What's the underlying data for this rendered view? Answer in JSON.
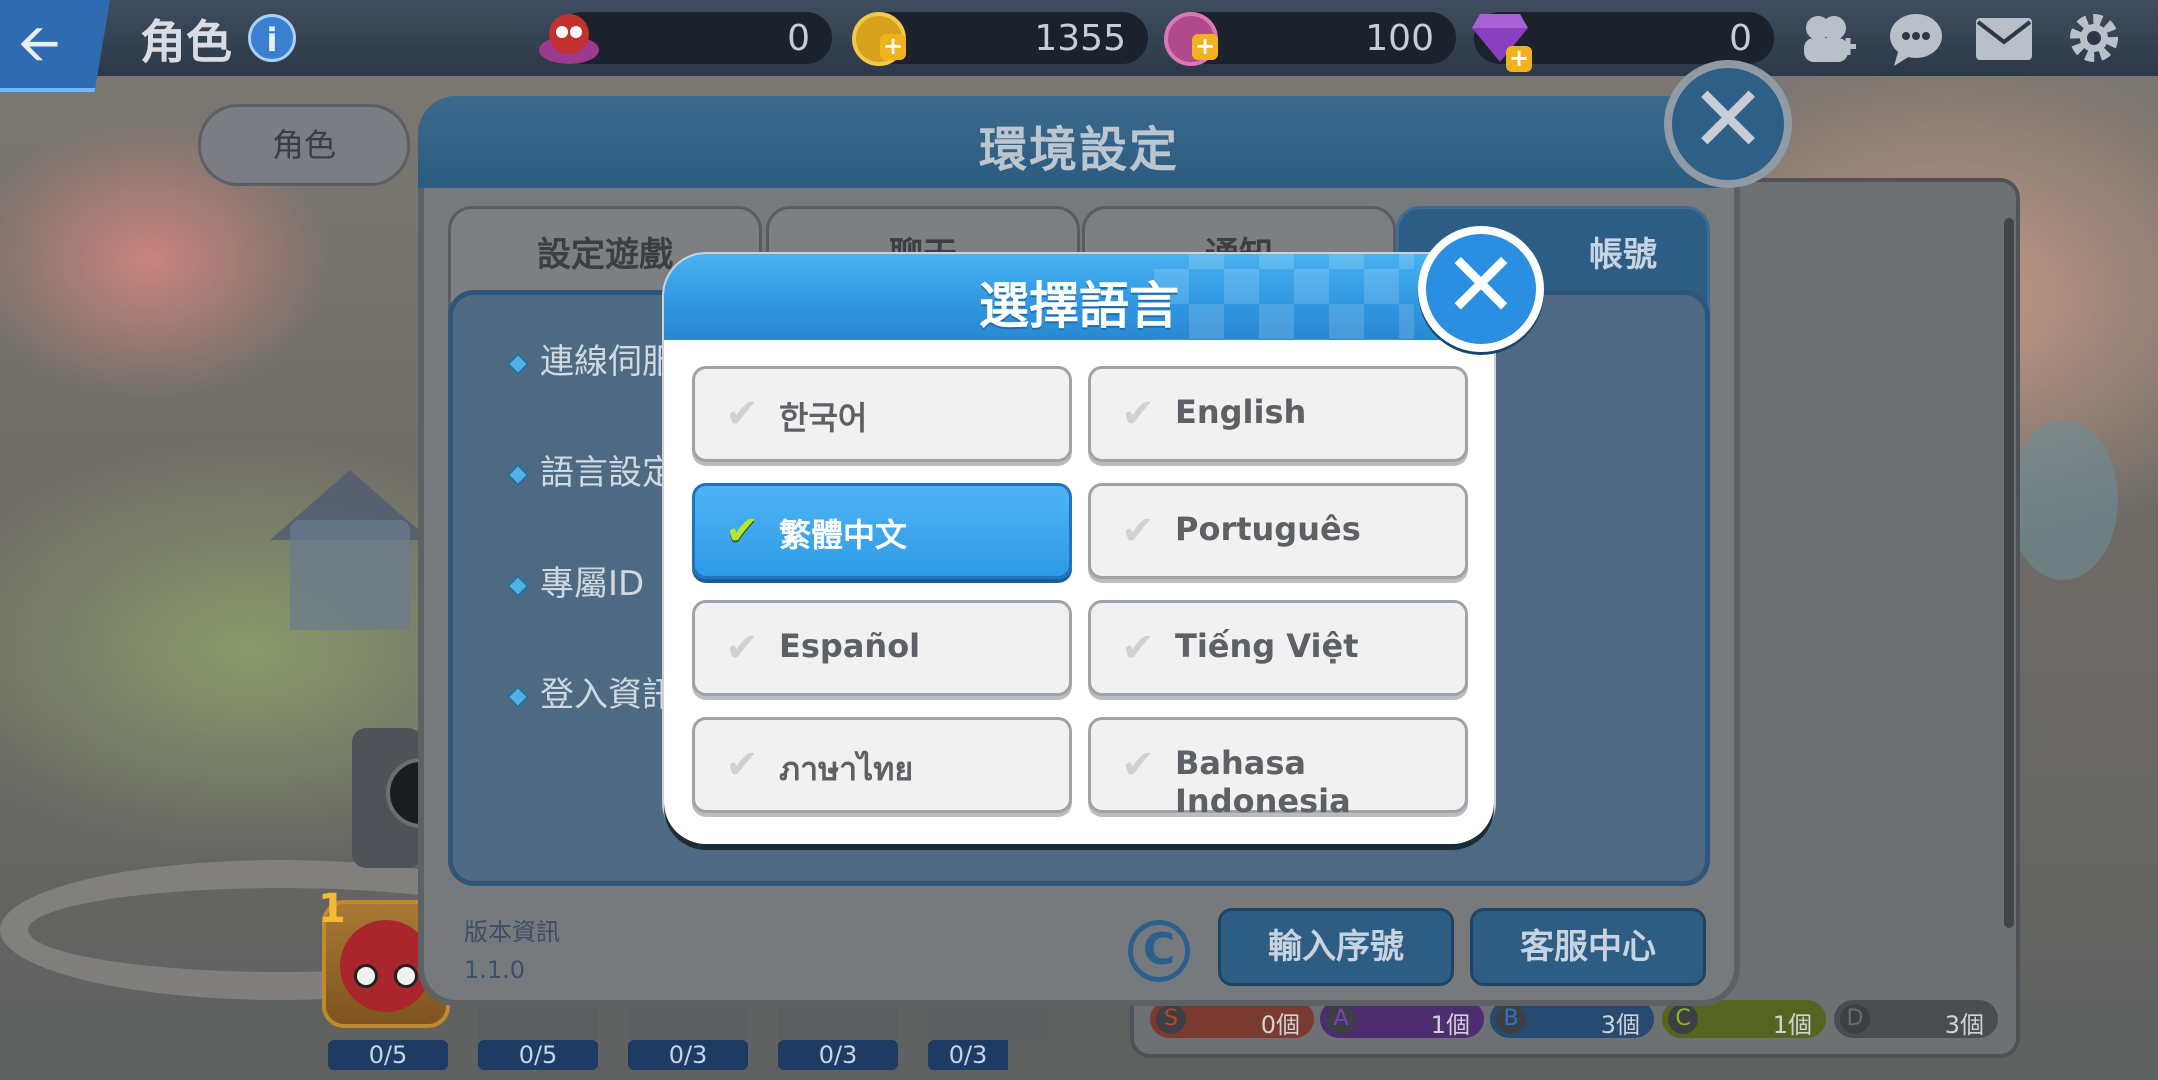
{
  "header": {
    "title": "角色",
    "resources": [
      {
        "icon": "character-gem-icon",
        "value": "0"
      },
      {
        "icon": "gold-coin-icon",
        "value": "1355"
      },
      {
        "icon": "pink-coin-icon",
        "value": "100"
      },
      {
        "icon": "diamond-icon",
        "value": "0"
      }
    ],
    "icons": [
      "add-friend-icon",
      "chat-icon",
      "mail-icon",
      "gear-icon"
    ]
  },
  "character_panel": {
    "tab_label": "角色",
    "level": "1",
    "slot_counts": [
      "0/5",
      "0/5",
      "0/3",
      "0/3",
      "0/3"
    ],
    "grades": [
      {
        "grade": "S",
        "count": "0個",
        "color": "#c0432a"
      },
      {
        "grade": "A",
        "count": "1個",
        "color": "#7a3fc2"
      },
      {
        "grade": "B",
        "count": "3個",
        "color": "#2f73c7"
      },
      {
        "grade": "C",
        "count": "1個",
        "color": "#8ab520"
      },
      {
        "grade": "D",
        "count": "3個",
        "color": "#6a6d70"
      }
    ]
  },
  "settings": {
    "title": "環境設定",
    "tabs": [
      "設定遊戲",
      "聊天",
      "通知",
      "帳號"
    ],
    "rows": [
      "連線伺服",
      "語言設定",
      "專屬ID",
      "登入資訊"
    ],
    "version_label": "版本資訊",
    "version": "1.1.0",
    "buttons": {
      "serial": "輸入序號",
      "support": "客服中心"
    }
  },
  "language_dialog": {
    "title": "選擇語言",
    "options": [
      {
        "label": "한국어",
        "selected": false
      },
      {
        "label": "English",
        "selected": false
      },
      {
        "label": "繁體中文",
        "selected": true
      },
      {
        "label": "Português",
        "selected": false
      },
      {
        "label": "Español",
        "selected": false
      },
      {
        "label": "Tiếng Việt",
        "selected": false
      },
      {
        "label": "ภาษาไทย",
        "selected": false
      },
      {
        "label": "Bahasa Indonesia",
        "selected": false
      }
    ]
  }
}
